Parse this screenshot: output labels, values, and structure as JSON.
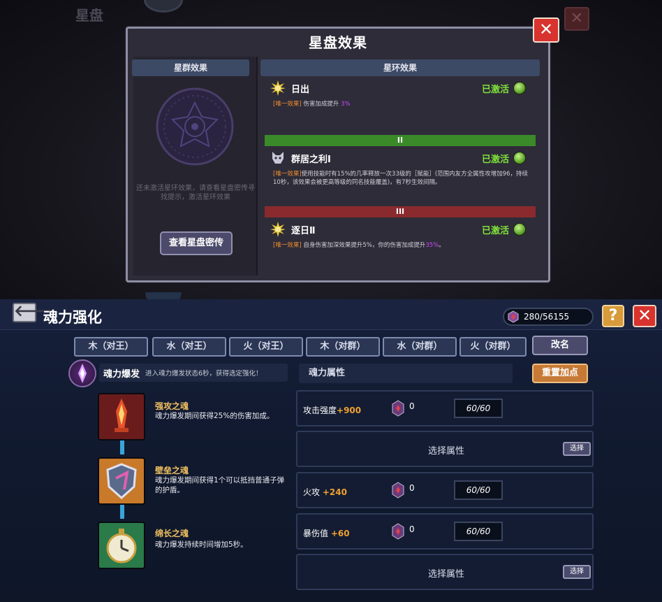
{
  "background_screen": {
    "title": "星盘"
  },
  "modal": {
    "title": "星盘效果",
    "left_header": "星群效果",
    "left_hint": "还未激活星环效果，请查看星盘密传寻找提示，激活星环效果",
    "view_button": "查看星盘密传",
    "right_header": "星环效果",
    "effects": [
      {
        "name": "日出",
        "status": "已激活",
        "tag": "[唯一效果]",
        "desc": "伤害加成提升",
        "value": "3%"
      },
      {
        "tier": "II",
        "name": "群居之利Ⅰ",
        "status": "已激活",
        "tag": "[唯一效果]",
        "desc": "使用技能时有15%的几率释放一次33级的［赋能］(范围内友方全属性攻增加96，持续10秒，该效果会被更高等级的同名技能覆盖)，有7秒生效间隔。"
      },
      {
        "tier": "III",
        "name": "逐日Ⅱ",
        "status": "已激活",
        "tag": "[唯一效果]",
        "desc": "自身伤害加深效果提升5%，你的伤害加成提升",
        "value": "35%",
        "suffix": "。"
      }
    ],
    "colors": {
      "tier2": "#3b8a2a",
      "tier3": "#8a2a2e",
      "active": "#7fe23a"
    }
  },
  "screen": {
    "title": "魂力强化",
    "currency": "280/56155",
    "help_label": "?",
    "close_label": "✕",
    "back_label": "🡐"
  },
  "tabs": [
    "木（对王）",
    "水（对王）",
    "火（对王）",
    "木（对群）",
    "水（对群）",
    "火（对群）"
  ],
  "rename_button": "改名",
  "skill": {
    "name": "魂力爆发",
    "desc": "进入魂力爆发状态6秒，获得选定强化！"
  },
  "nodes": [
    {
      "name": "强攻之魂",
      "desc": "魂力爆发期间获得25%的伤害加成。"
    },
    {
      "name": "壁垒之魂",
      "desc": "魂力爆发期间获得1个可以抵挡普通子弹的护盾。"
    },
    {
      "name": "绵长之魂",
      "desc": "魂力爆发持续时间增加5秒。"
    }
  ],
  "attributes": {
    "header": "魂力属性",
    "reset_button": "重置加点",
    "rows": [
      {
        "label": "攻击强度",
        "bonus": "+900",
        "count": "0",
        "value": "60/60"
      },
      {
        "empty": "选择属性",
        "button": "选择"
      },
      {
        "label": "火攻",
        "bonus": "+240",
        "count": "0",
        "value": "60/60"
      },
      {
        "label": "暴伤值",
        "bonus": "+60",
        "count": "0",
        "value": "60/60"
      },
      {
        "empty": "选择属性",
        "button": "选择"
      }
    ]
  }
}
